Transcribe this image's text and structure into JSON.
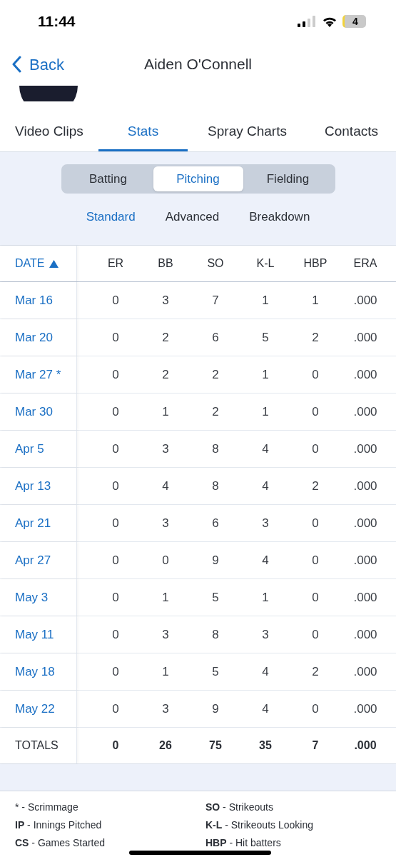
{
  "status_bar": {
    "time": "11:44",
    "battery": "4"
  },
  "nav": {
    "back": "Back",
    "title": "Aiden O'Connell"
  },
  "tabs": [
    {
      "label": "Video Clips",
      "selected": false
    },
    {
      "label": "Stats",
      "selected": true
    },
    {
      "label": "Spray Charts",
      "selected": false
    },
    {
      "label": "Contacts",
      "selected": false
    }
  ],
  "segments": [
    {
      "label": "Batting",
      "selected": false
    },
    {
      "label": "Pitching",
      "selected": true
    },
    {
      "label": "Fielding",
      "selected": false
    }
  ],
  "views": [
    {
      "label": "Standard",
      "selected": true
    },
    {
      "label": "Advanced",
      "selected": false
    },
    {
      "label": "Breakdown",
      "selected": false
    }
  ],
  "table": {
    "columns": [
      {
        "label": "DATE",
        "sorted": true
      },
      {
        "label": "ER",
        "sorted": false
      },
      {
        "label": "BB",
        "sorted": false
      },
      {
        "label": "SO",
        "sorted": false
      },
      {
        "label": "K-L",
        "sorted": false
      },
      {
        "label": "HBP",
        "sorted": false
      },
      {
        "label": "ERA",
        "sorted": false
      }
    ],
    "rows": [
      [
        "Mar 16",
        "0",
        "3",
        "7",
        "1",
        "1",
        ".000"
      ],
      [
        "Mar 20",
        "0",
        "2",
        "6",
        "5",
        "2",
        ".000"
      ],
      [
        "Mar 27 *",
        "0",
        "2",
        "2",
        "1",
        "0",
        ".000"
      ],
      [
        "Mar 30",
        "0",
        "1",
        "2",
        "1",
        "0",
        ".000"
      ],
      [
        "Apr 5",
        "0",
        "3",
        "8",
        "4",
        "0",
        ".000"
      ],
      [
        "Apr 13",
        "0",
        "4",
        "8",
        "4",
        "2",
        ".000"
      ],
      [
        "Apr 21",
        "0",
        "3",
        "6",
        "3",
        "0",
        ".000"
      ],
      [
        "Apr 27",
        "0",
        "0",
        "9",
        "4",
        "0",
        ".000"
      ],
      [
        "May 3",
        "0",
        "1",
        "5",
        "1",
        "0",
        ".000"
      ],
      [
        "May 11",
        "0",
        "3",
        "8",
        "3",
        "0",
        ".000"
      ],
      [
        "May 18",
        "0",
        "1",
        "5",
        "4",
        "2",
        ".000"
      ],
      [
        "May 22",
        "0",
        "3",
        "9",
        "4",
        "0",
        ".000"
      ]
    ],
    "totals": [
      "TOTALS",
      "0",
      "26",
      "75",
      "35",
      "7",
      ".000"
    ]
  },
  "legend": [
    "* - Scrimmage",
    "**SO** - Strikeouts",
    "**IP** - Innings Pitched",
    "**K-L** - Strikeouts Looking",
    "**CS** - Games Started",
    "**HBP** - Hit batters"
  ]
}
